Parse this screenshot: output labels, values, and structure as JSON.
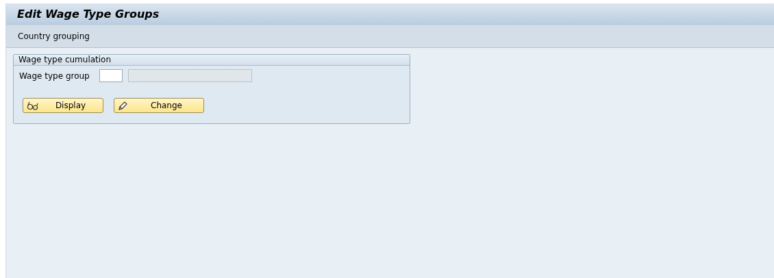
{
  "window": {
    "title": "Edit Wage Type Groups"
  },
  "toolbar": {
    "items": [
      "Country grouping"
    ]
  },
  "group": {
    "title": "Wage type cumulation",
    "field": {
      "label": "Wage type group",
      "code_disabled": false,
      "description_disabled": true
    },
    "buttons": [
      {
        "label": "Display",
        "kind": "display"
      },
      {
        "label": "Change",
        "kind": "change"
      }
    ]
  }
}
